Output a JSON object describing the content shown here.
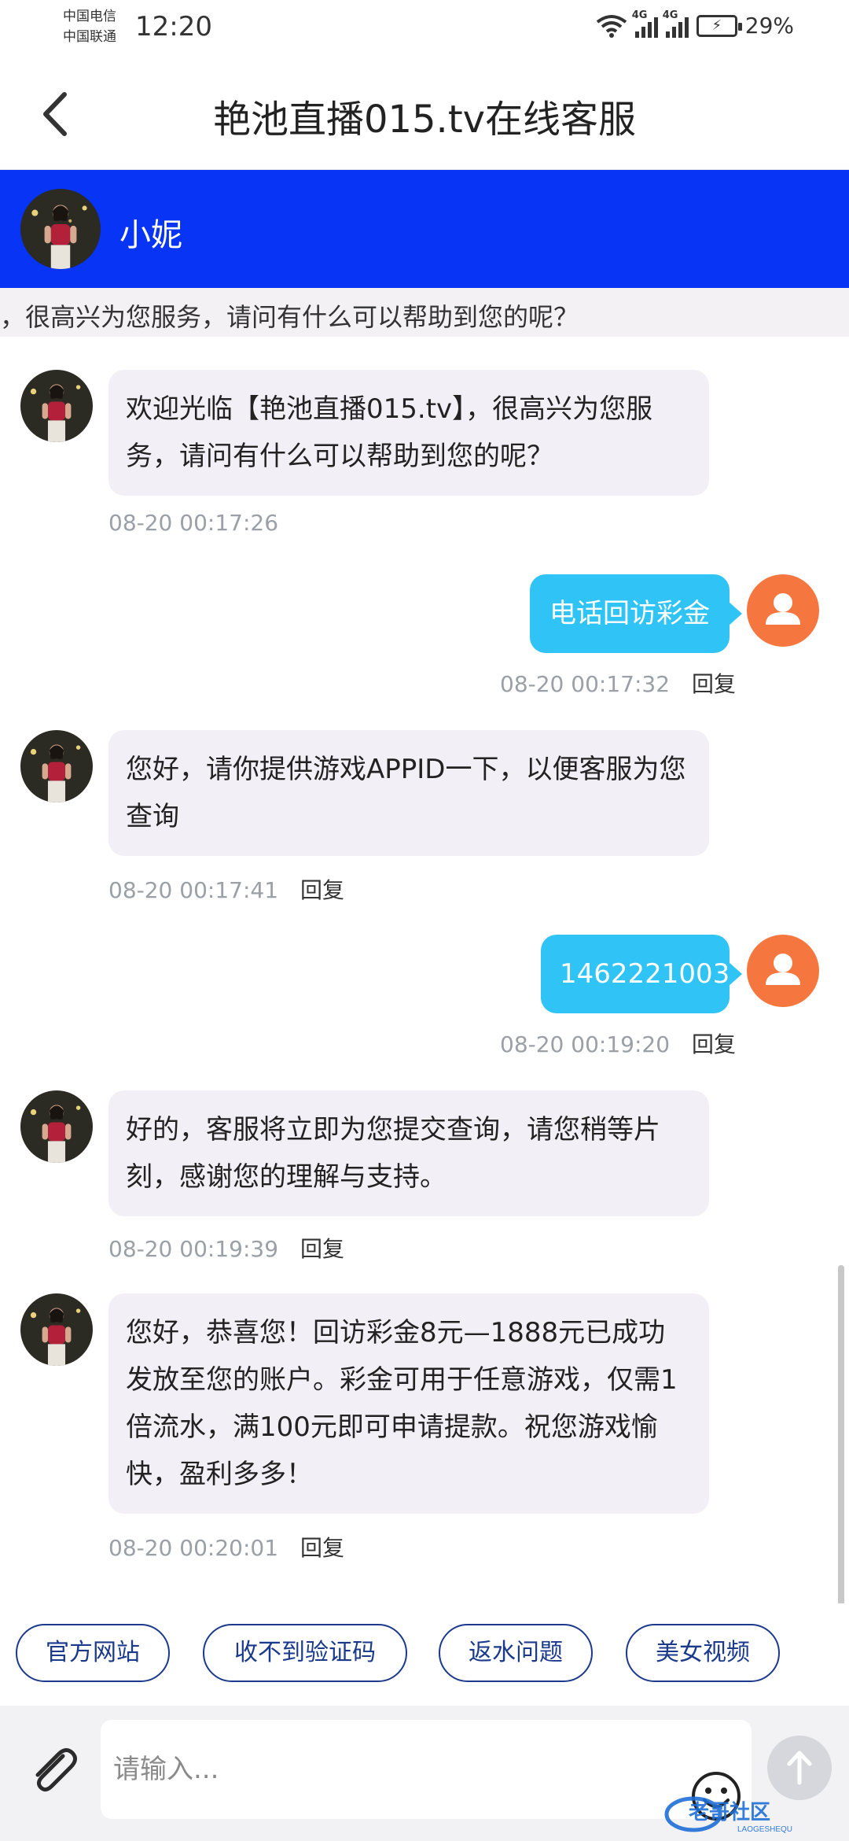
{
  "status_bar": {
    "carrier_1": "中国电信",
    "carrier_2": "中国联通",
    "time": "12:20",
    "battery": "29%",
    "signal_tag": "4G"
  },
  "header": {
    "title": "艳池直播015.tv在线客服"
  },
  "agent": {
    "name": "小妮"
  },
  "marquee": {
    "text": "，很高兴为您服务，请问有什么可以帮助到您的呢？"
  },
  "messages": [
    {
      "from": "agent",
      "text": "欢迎光临【艳池直播015.tv】，很高兴为您服务，请问有什么可以帮助到您的呢？",
      "time": "08-20 00:17:26",
      "reply": ""
    },
    {
      "from": "user",
      "text": "电话回访彩金",
      "time": "08-20 00:17:32",
      "reply": "回复"
    },
    {
      "from": "agent",
      "text": "您好，请你提供游戏APPID一下，以便客服为您查询",
      "time": "08-20 00:17:41",
      "reply": "回复"
    },
    {
      "from": "user",
      "text": "1462221003",
      "time": "08-20 00:19:20",
      "reply": "回复"
    },
    {
      "from": "agent",
      "text": "好的，客服将立即为您提交查询，请您稍等片刻，感谢您的理解与支持。",
      "time": "08-20 00:19:39",
      "reply": "回复"
    },
    {
      "from": "agent",
      "text": "您好，恭喜您！回访彩金8元—1888元已成功发放至您的账户。彩金可用于任意游戏，仅需1倍流水，满100元即可申请提款。祝您游戏愉快，盈利多多！",
      "time": "08-20 00:20:01",
      "reply": "回复"
    }
  ],
  "quick_replies": [
    "官方网站",
    "收不到验证码",
    "返水问题",
    "美女视频"
  ],
  "input": {
    "placeholder": "请输入..."
  },
  "watermark": {
    "text": "老哥社区",
    "sub": "LAOGESHEQU"
  },
  "colors": {
    "agent_header": "#0734f5",
    "user_bubble": "#30c4f6",
    "agent_bubble": "#f3eff6",
    "user_avatar": "#f5773f",
    "chip_border": "#1b3a8c"
  }
}
